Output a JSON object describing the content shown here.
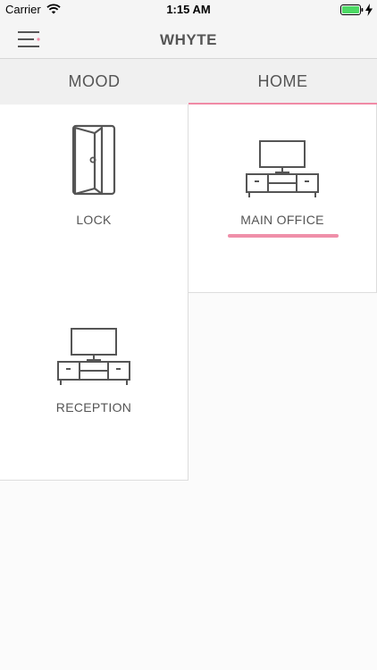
{
  "status_bar": {
    "carrier": "Carrier",
    "time": "1:15 AM",
    "battery_color": "#4cd964"
  },
  "nav": {
    "title": "WHYTE",
    "menu_icon": "hamburger-menu-icon",
    "accent_color": "#f08aa6"
  },
  "tabs": [
    {
      "label": "MOOD",
      "active": false
    },
    {
      "label": "HOME",
      "active": true
    }
  ],
  "tiles": [
    {
      "label": "LOCK",
      "icon": "door-icon",
      "active": false
    },
    {
      "label": "MAIN OFFICE",
      "icon": "tv-stand-icon",
      "active": true
    },
    {
      "label": "RECEPTION",
      "icon": "tv-stand-icon",
      "active": false
    }
  ]
}
